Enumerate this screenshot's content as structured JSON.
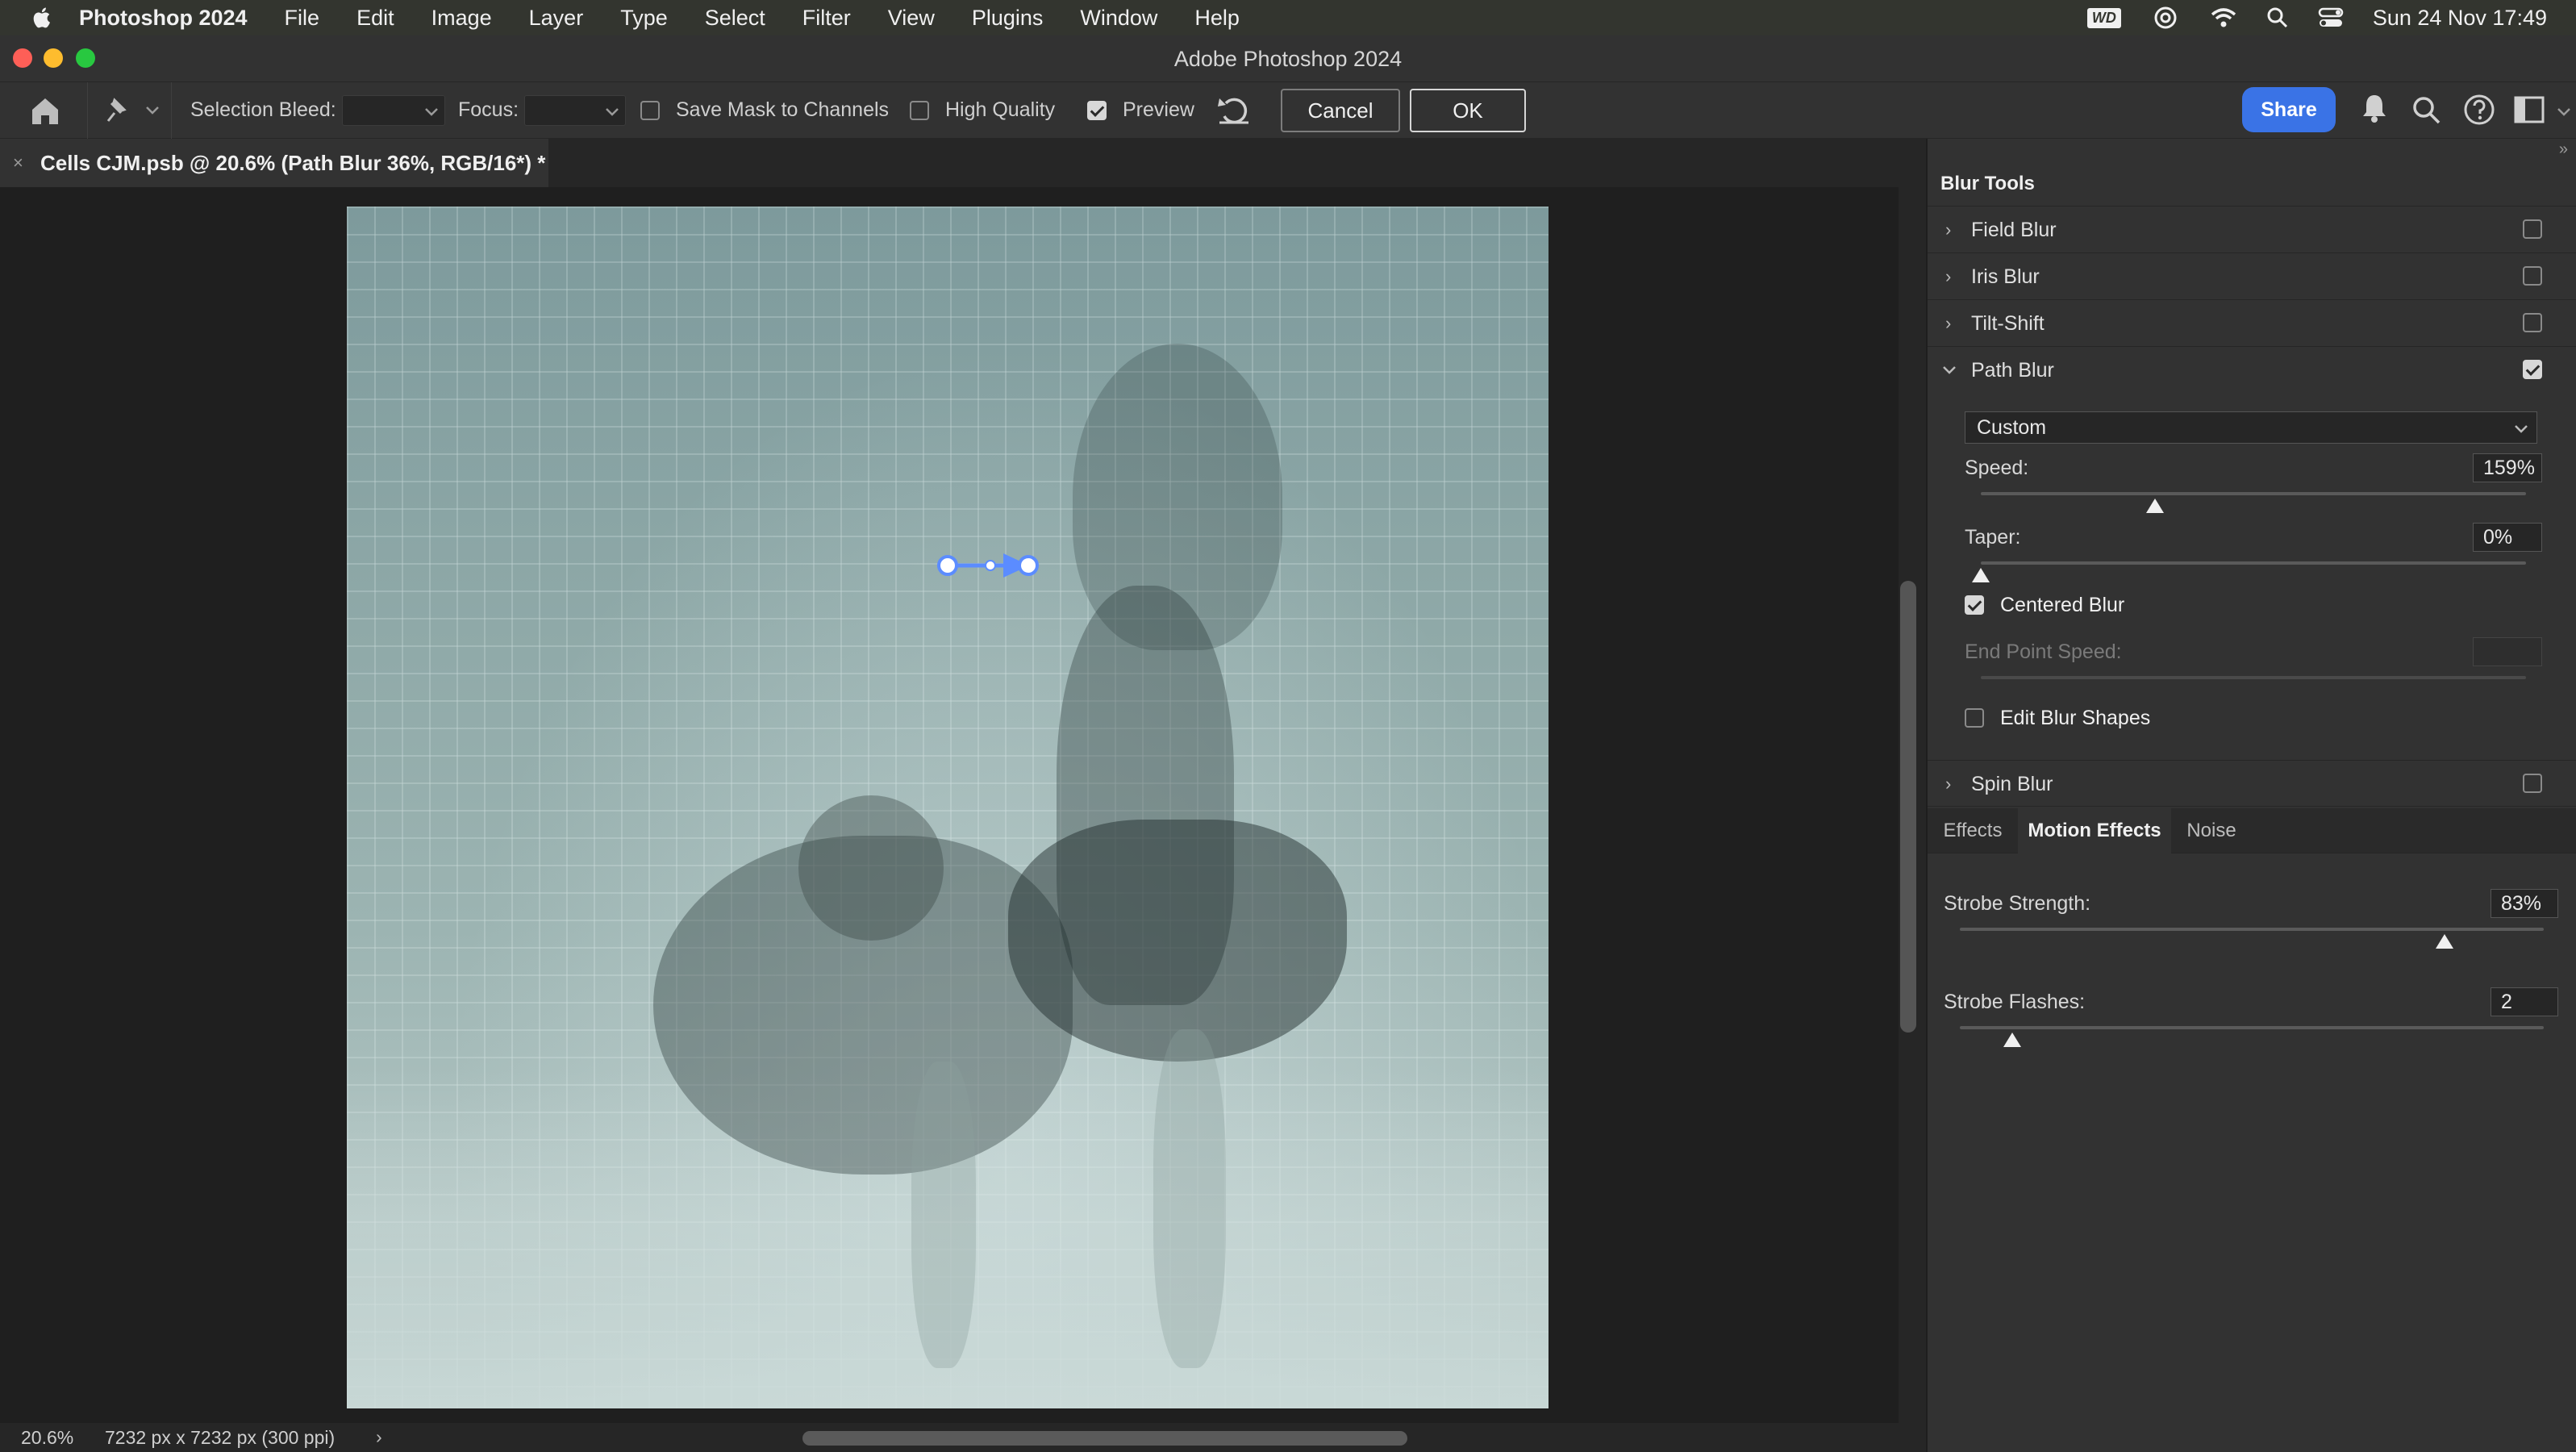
{
  "menubar": {
    "app_name": "Photoshop 2024",
    "items": [
      "File",
      "Edit",
      "Image",
      "Layer",
      "Type",
      "Select",
      "Filter",
      "View",
      "Plugins",
      "Window",
      "Help"
    ],
    "wd_badge": "WD",
    "datetime": "Sun 24 Nov  17:49"
  },
  "window": {
    "title": "Adobe Photoshop 2024"
  },
  "options": {
    "selection_bleed_label": "Selection Bleed:",
    "focus_label": "Focus:",
    "save_mask_label": "Save Mask to Channels",
    "save_mask_checked": false,
    "high_quality_label": "High Quality",
    "high_quality_checked": false,
    "preview_label": "Preview",
    "preview_checked": true,
    "cancel_label": "Cancel",
    "ok_label": "OK",
    "share_label": "Share"
  },
  "document_tab": {
    "title": "Cells CJM.psb @ 20.6% (Path Blur 36%, RGB/16*) *"
  },
  "status": {
    "zoom": "20.6%",
    "doc_info": "7232 px x 7232 px (300 ppi)"
  },
  "blur_tools": {
    "header": "Blur Tools",
    "tools": [
      {
        "label": "Field Blur",
        "checked": false,
        "expanded": false
      },
      {
        "label": "Iris Blur",
        "checked": false,
        "expanded": false
      },
      {
        "label": "Tilt-Shift",
        "checked": false,
        "expanded": false
      },
      {
        "label": "Path Blur",
        "checked": true,
        "expanded": true
      },
      {
        "label": "Spin Blur",
        "checked": false,
        "expanded": false
      }
    ],
    "path_blur": {
      "preset": "Custom",
      "speed_label": "Speed:",
      "speed_value": "159%",
      "speed_fraction": 0.32,
      "taper_label": "Taper:",
      "taper_value": "0%",
      "taper_fraction": 0.0,
      "centered_blur_label": "Centered Blur",
      "centered_blur_checked": true,
      "end_point_speed_label": "End Point Speed:",
      "edit_blur_shapes_label": "Edit Blur Shapes",
      "edit_blur_shapes_checked": false
    }
  },
  "effects_tabs": {
    "tabs": [
      "Effects",
      "Motion Effects",
      "Noise"
    ],
    "active": "Motion Effects",
    "strobe_strength_label": "Strobe Strength:",
    "strobe_strength_value": "83%",
    "strobe_strength_fraction": 0.83,
    "strobe_flashes_label": "Strobe Flashes:",
    "strobe_flashes_value": "2",
    "strobe_flashes_fraction": 0.09
  },
  "colors": {
    "accent": "#3a73e6",
    "path_handle": "#5b8cff"
  }
}
